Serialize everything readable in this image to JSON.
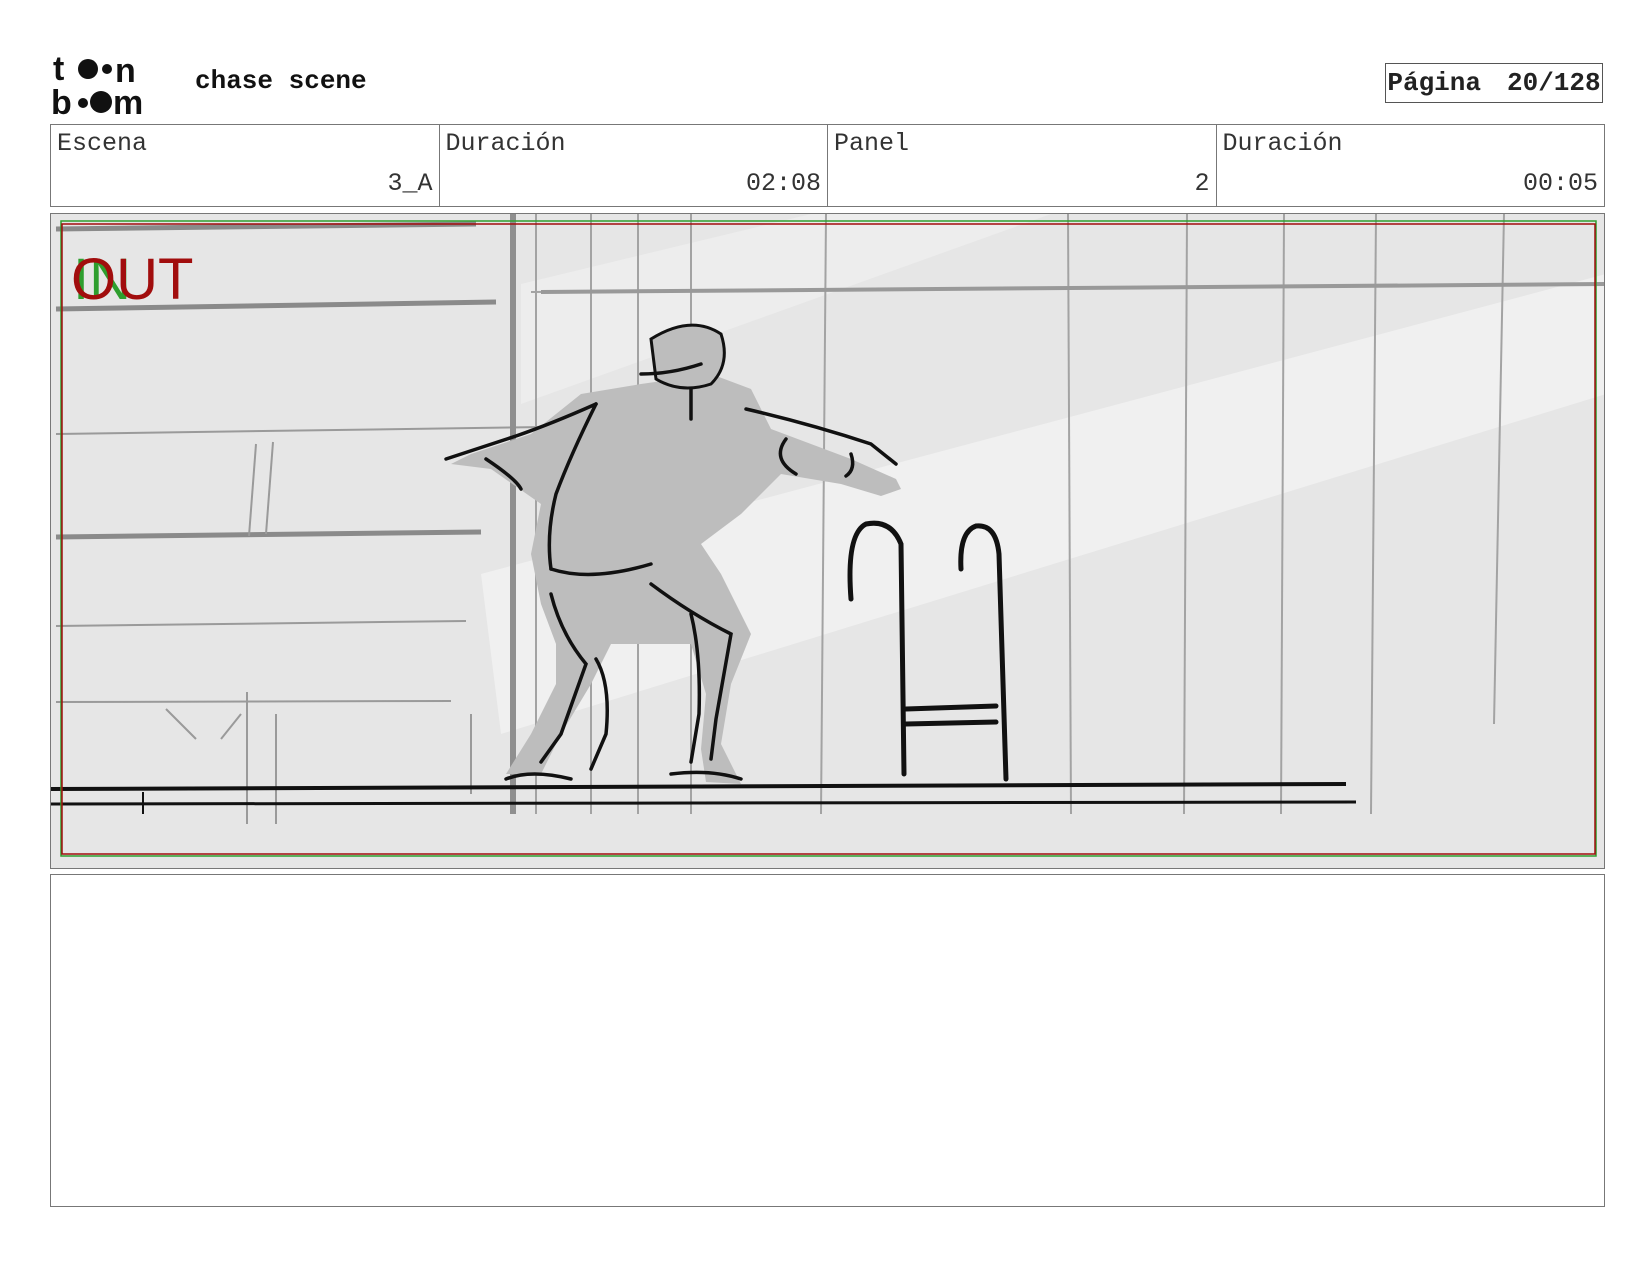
{
  "header": {
    "logo_text": "toon boom",
    "project_title": "chase scene",
    "page_label": "Página",
    "page_value": "20/128"
  },
  "info": [
    {
      "label": "Escena",
      "value": "3_A"
    },
    {
      "label": "Duración",
      "value": "02:08"
    },
    {
      "label": "Panel",
      "value": "2"
    },
    {
      "label": "Duración",
      "value": "00:05"
    }
  ],
  "panel": {
    "in_marker": "IN",
    "out_marker": "OUT",
    "colors": {
      "in": "#2e9e2e",
      "out": "#a10d0d",
      "background": "#e6e6e6"
    }
  },
  "notes": {
    "text": ""
  }
}
